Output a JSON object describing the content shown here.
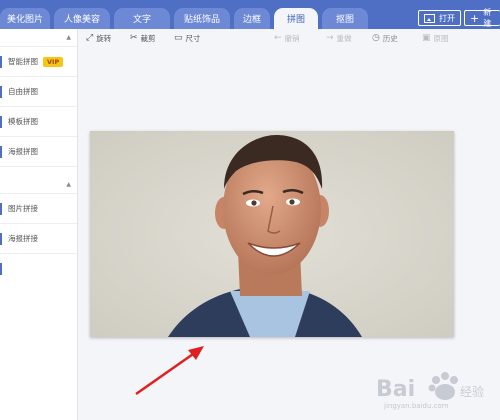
{
  "tabs": [
    {
      "label": "美化图片",
      "active": false
    },
    {
      "label": "人像美容",
      "active": false
    },
    {
      "label": "文字",
      "active": false
    },
    {
      "label": "贴纸饰品",
      "active": false
    },
    {
      "label": "边框",
      "active": false
    },
    {
      "label": "拼图",
      "active": true
    },
    {
      "label": "抠图",
      "active": false
    }
  ],
  "top_actions": {
    "open": "打开",
    "new": "新建"
  },
  "sidebar": {
    "group1": [
      "智能拼图",
      "自由拼图",
      "模板拼图",
      "海报拼图"
    ],
    "vip_badge": "VIP",
    "group2": [
      "图片拼接",
      "海报拼接"
    ]
  },
  "toolbar": {
    "rotate": "旋转",
    "crop": "裁剪",
    "size": "尺寸",
    "undo": "撤销",
    "redo": "重做",
    "history": "历史",
    "original": "原图"
  },
  "watermark": "jingyan.baidu.com",
  "colors": {
    "accent": "#4f6fc4",
    "tab_bar": "#4f6fc4",
    "vip": "#f5c518",
    "arrow": "#e02020"
  }
}
